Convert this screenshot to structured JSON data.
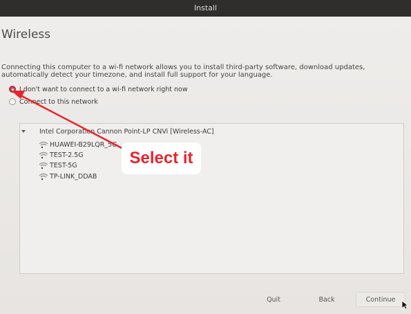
{
  "window": {
    "title": "Install"
  },
  "page": {
    "title": "Wireless",
    "description": "Connecting this computer to a wi-fi network allows you to install third-party software, download updates, automatically detect your timezone, and install full support for your language."
  },
  "options": {
    "no_connect": {
      "label": "I don't want to connect to a wi-fi network right now",
      "selected": true
    },
    "connect": {
      "label": "Connect to this network",
      "selected": false
    }
  },
  "adapter": {
    "name": "Intel Corporation Cannon Point-LP CNVi [Wireless-AC]",
    "expanded": true
  },
  "networks": [
    {
      "ssid": "HUAWEI-B29LQR_5G"
    },
    {
      "ssid": "TEST-2.5G"
    },
    {
      "ssid": "TEST-5G"
    },
    {
      "ssid": "TP-LINK_DDAB"
    }
  ],
  "buttons": {
    "quit": "Quit",
    "back": "Back",
    "continue": "Continue"
  },
  "annotation": {
    "text": "Select it",
    "color": "#e8242c"
  },
  "icons": {
    "network": "wifi-icon",
    "pointer": "mouse-pointer-icon"
  },
  "colors": {
    "accent": "#c03f4d",
    "titlebar": "#2f2e2c"
  }
}
